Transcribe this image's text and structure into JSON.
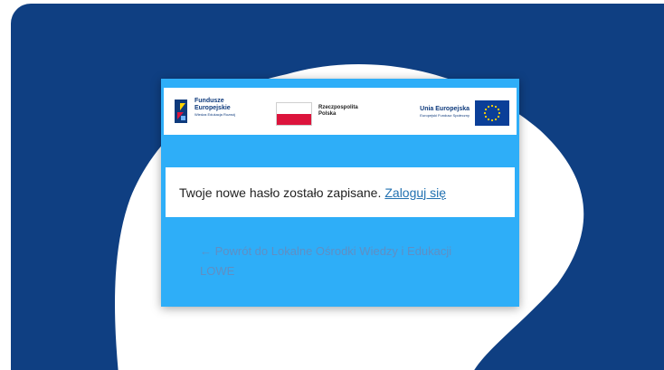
{
  "logos": {
    "fundusze_line1": "Fundusze",
    "fundusze_line2": "Europejskie",
    "fundusze_sub": "Wiedza Edukacja Rozwój",
    "polska_line1": "Rzeczpospolita",
    "polska_line2": "Polska",
    "ue_title": "Unia Europejska",
    "ue_sub": "Europejski Fundusz Społeczny"
  },
  "message": {
    "text": "Twoje nowe hasło zostało zapisane.",
    "login_link": "Zaloguj się"
  },
  "back_link": "← Powrót do Lokalne Ośrodki Wiedzy i Edukacji LOWE",
  "colors": {
    "background_dark": "#0f3f82",
    "card_accent": "#2eaef8",
    "link": "#2271b1",
    "back_link": "#5f8fc4"
  }
}
